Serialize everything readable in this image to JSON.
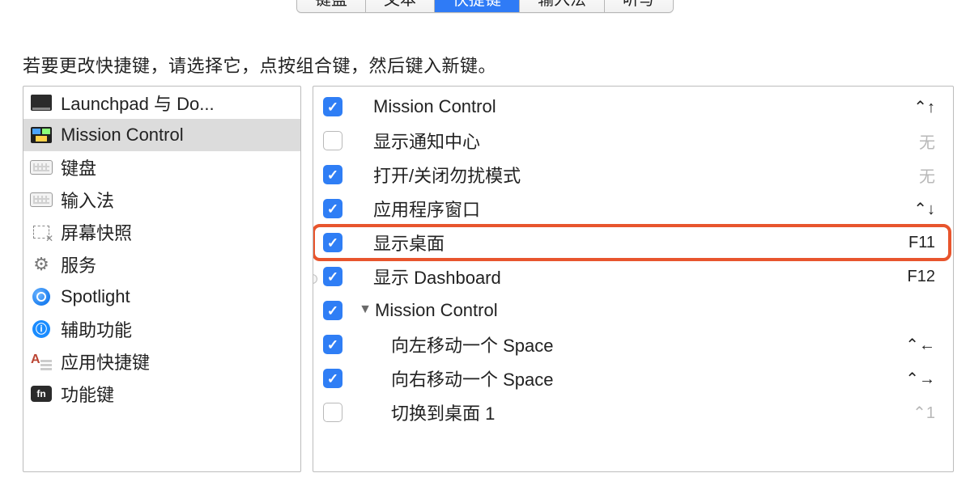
{
  "tabs": {
    "items": [
      {
        "label": "键盘",
        "active": false
      },
      {
        "label": "文本",
        "active": false
      },
      {
        "label": "快捷键",
        "active": true
      },
      {
        "label": "输入法",
        "active": false
      },
      {
        "label": "听写",
        "active": false
      }
    ]
  },
  "instruction": "若要更改快捷键，请选择它，点按组合键，然后键入新键。",
  "categories": [
    {
      "icon": "launchpad",
      "label": "Launchpad 与 Do...",
      "selected": false
    },
    {
      "icon": "mc",
      "label": "Mission Control",
      "selected": true
    },
    {
      "icon": "keyboard",
      "label": "键盘",
      "selected": false
    },
    {
      "icon": "keyboard",
      "label": "输入法",
      "selected": false
    },
    {
      "icon": "screenshot",
      "label": "屏幕快照",
      "selected": false
    },
    {
      "icon": "services",
      "label": "服务",
      "selected": false
    },
    {
      "icon": "spotlight",
      "label": "Spotlight",
      "selected": false
    },
    {
      "icon": "access",
      "label": "辅助功能",
      "selected": false
    },
    {
      "icon": "apps",
      "label": "应用快捷键",
      "selected": false
    },
    {
      "icon": "fn",
      "label": "功能键",
      "selected": false
    }
  ],
  "shortcuts": [
    {
      "checked": true,
      "label": "Mission Control",
      "accel": "⌃↑",
      "dim": false,
      "indent": 0,
      "highlight": false
    },
    {
      "checked": false,
      "label": "显示通知中心",
      "accel": "无",
      "dim": true,
      "indent": 0,
      "highlight": false
    },
    {
      "checked": true,
      "label": "打开/关闭勿扰模式",
      "accel": "无",
      "dim": true,
      "indent": 0,
      "highlight": false
    },
    {
      "checked": true,
      "label": "应用程序窗口",
      "accel": "⌃↓",
      "dim": false,
      "indent": 0,
      "highlight": false
    },
    {
      "checked": true,
      "label": "显示桌面",
      "accel": "F11",
      "dim": false,
      "indent": 0,
      "highlight": true
    },
    {
      "checked": true,
      "label": "显示 Dashboard",
      "accel": "F12",
      "dim": false,
      "indent": 0,
      "highlight": false
    },
    {
      "checked": true,
      "label": "Mission Control",
      "accel": "",
      "dim": false,
      "indent": 0,
      "header": true,
      "disclosure": "down"
    },
    {
      "checked": true,
      "label": "向左移动一个 Space",
      "accel": "⌃←",
      "dim": false,
      "indent": 1,
      "highlight": false
    },
    {
      "checked": true,
      "label": "向右移动一个 Space",
      "accel": "⌃→",
      "dim": false,
      "indent": 1,
      "highlight": false
    },
    {
      "checked": false,
      "label": "切换到桌面 1",
      "accel": "⌃1",
      "dim": true,
      "indent": 1,
      "highlight": false
    }
  ]
}
